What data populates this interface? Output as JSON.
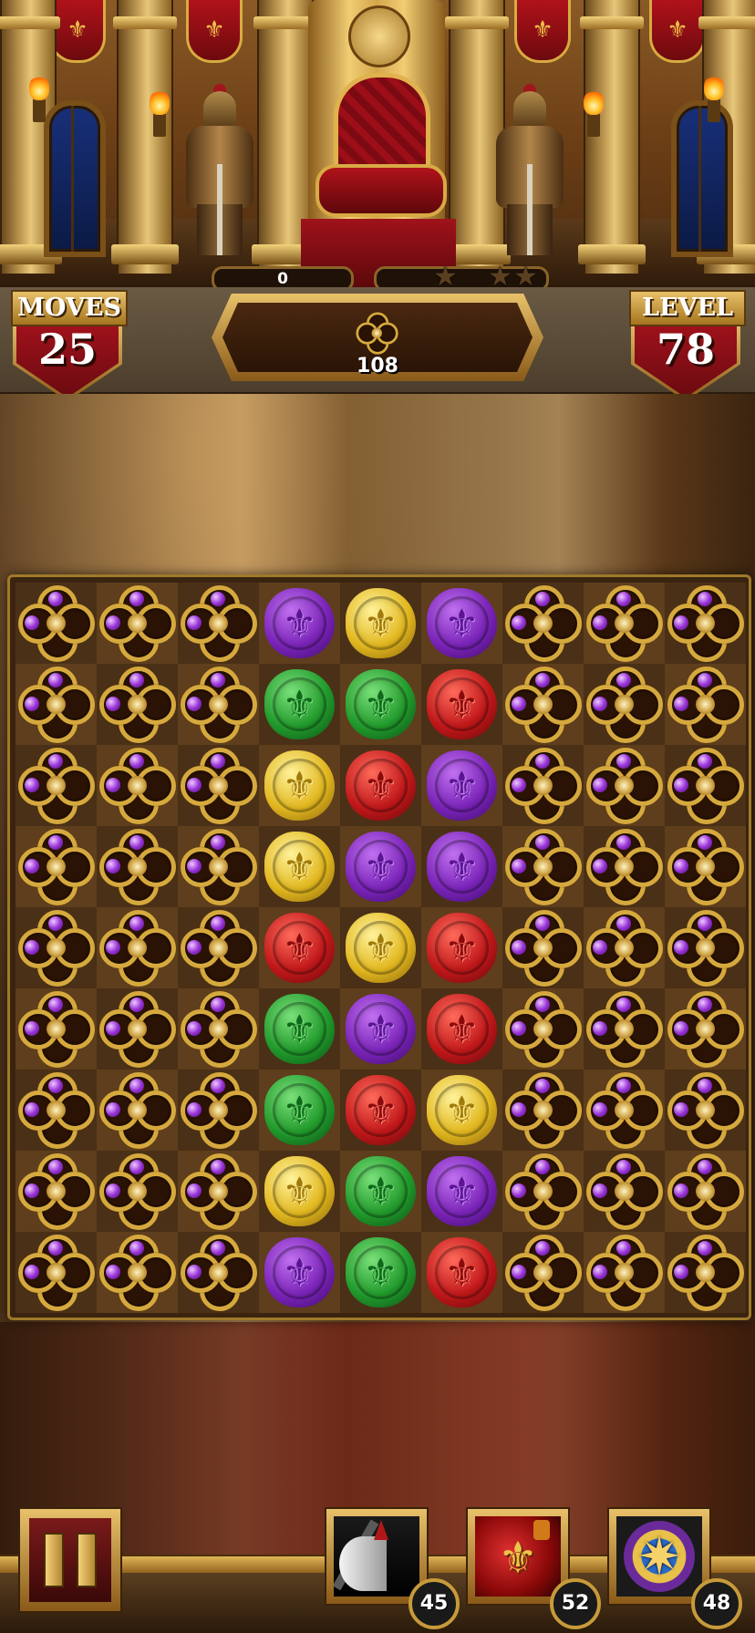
{
  "hud": {
    "moves_label": "MOVES",
    "moves_value": "25",
    "level_label": "LEVEL",
    "level_value": "78",
    "score": "0",
    "stars_earned": 0,
    "stars_total": 3,
    "goal_count": "108",
    "goal_icon": "gold-rosette-tile-icon"
  },
  "board": {
    "rows": [
      [
        "rosette",
        "rosette",
        "rosette",
        "purple",
        "yellow",
        "purple",
        "rosette",
        "rosette",
        "rosette"
      ],
      [
        "rosette",
        "rosette",
        "rosette",
        "green",
        "green",
        "red",
        "rosette",
        "rosette",
        "rosette"
      ],
      [
        "rosette",
        "rosette",
        "rosette",
        "yellow",
        "red",
        "purple",
        "rosette",
        "rosette",
        "rosette"
      ],
      [
        "rosette",
        "rosette",
        "rosette",
        "yellow",
        "purple",
        "purple",
        "rosette",
        "rosette",
        "rosette"
      ],
      [
        "rosette",
        "rosette",
        "rosette",
        "red",
        "yellow",
        "red",
        "rosette",
        "rosette",
        "rosette"
      ],
      [
        "rosette",
        "rosette",
        "rosette",
        "green",
        "purple",
        "red",
        "rosette",
        "rosette",
        "rosette"
      ],
      [
        "rosette",
        "rosette",
        "rosette",
        "green",
        "red",
        "yellow",
        "rosette",
        "rosette",
        "rosette"
      ],
      [
        "rosette",
        "rosette",
        "rosette",
        "yellow",
        "green",
        "purple",
        "rosette",
        "rosette",
        "rosette"
      ],
      [
        "rosette",
        "rosette",
        "rosette",
        "purple",
        "green",
        "red",
        "rosette",
        "rosette",
        "rosette"
      ]
    ],
    "seal_symbol": "⚜"
  },
  "boosters": [
    {
      "name": "axe-booster",
      "icon": "halberd-axe-icon",
      "count": "45"
    },
    {
      "name": "bomb-booster",
      "icon": "fleur-bomb-icon",
      "count": "52"
    },
    {
      "name": "compass-booster",
      "icon": "compass-star-icon",
      "count": "48"
    }
  ],
  "colors": {
    "purple": "#7a24b8",
    "yellow": "#e2b820",
    "green": "#229a2c",
    "red": "#c0181a",
    "gold": "#d6a93e"
  }
}
